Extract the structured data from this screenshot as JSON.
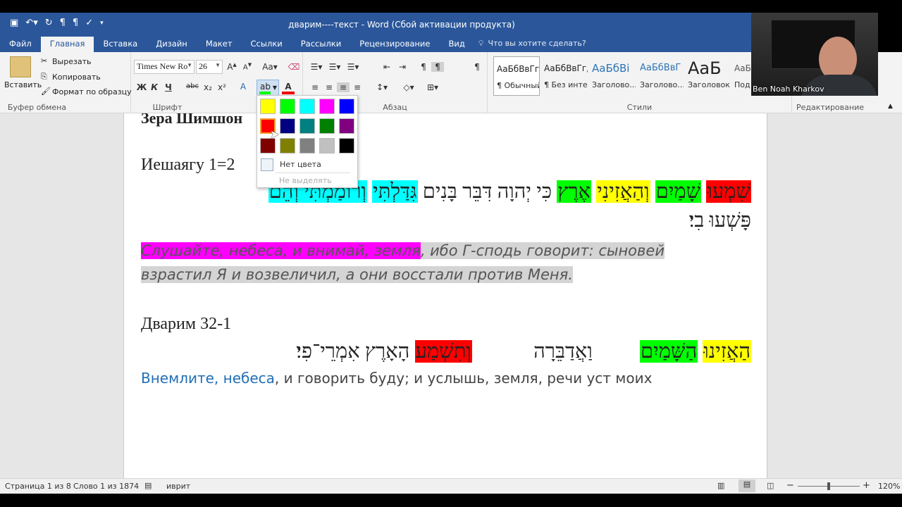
{
  "window": {
    "title": "дварим----текст - Word (Сбой активации продукта)"
  },
  "tabs": [
    "Файл",
    "Главная",
    "Вставка",
    "Дизайн",
    "Макет",
    "Ссылки",
    "Рассылки",
    "Рецензирование",
    "Вид"
  ],
  "tell_me": "Что вы хотите сделать?",
  "clipboard": {
    "paste": "Вставить",
    "cut": "Вырезать",
    "copy": "Копировать",
    "format_painter": "Формат по образцу",
    "label": "Буфер обмена"
  },
  "font": {
    "name": "Times New Ro",
    "size": "26",
    "bold": "Ж",
    "italic": "К",
    "underline": "Ч",
    "strike": "abc",
    "sub": "x₂",
    "sup": "x²",
    "label": "Шрифт"
  },
  "paragraph": {
    "label": "Абзац"
  },
  "styles": {
    "label": "Стили",
    "items": [
      {
        "preview": "АаБбВвГг,",
        "name": "¶ Обычный"
      },
      {
        "preview": "АаБбВвГг,",
        "name": "¶ Без инте..."
      },
      {
        "preview": "АаБбВі",
        "name": "Заголово..."
      },
      {
        "preview": "АаБбВвГ",
        "name": "Заголово..."
      },
      {
        "preview": "АаБ",
        "name": "Заголовок"
      },
      {
        "preview": "АаБ",
        "name": "Под"
      }
    ]
  },
  "editing": {
    "label": "Редактирование"
  },
  "highlight_menu": {
    "colors": [
      "#ffff00",
      "#00ff00",
      "#00ffff",
      "#ff00ff",
      "#0000ff",
      "#ff0000",
      "#000080",
      "#008080",
      "#008000",
      "#800080",
      "#800000",
      "#808000",
      "#808080",
      "#c0c0c0",
      "#000000"
    ],
    "no_color": "Нет цвета",
    "stop": "Не выделять"
  },
  "document": {
    "top_heading": "Зера Шимшон",
    "s1_title": "Иешаягу 1=2",
    "s1_hebrew_line1": [
      "שִׁמְעוּ",
      "שָׁמַיִם",
      "וְהַאֲזִינִי",
      "אֶרֶץ",
      "כִּי יְהוָה דִּבֵּר בָּנִים",
      "גִּדַּלְתִּי",
      "וְרוֹמַמְתִּי וְהֵם"
    ],
    "s1_hebrew_line2": "פָּשְׁעוּ בִי׃",
    "s1_ru_hl": "Слушайте, небеса, и внимай, земля",
    "s1_ru_rest": ", ибо Г-сподь говорит: сыновей",
    "s1_ru_line2": "взрастил Я и возвеличил, а они восстали против Меня.",
    "s2_title": "Дварим 32-1",
    "s2_hebrew": [
      "הַאֲזִינוּ",
      "הַשָּׁמַיִם",
      "וַאֲדַבֵּרָה",
      "וְתִשְׁמַע",
      "הָאָרֶץ אִמְרֵי־פִי׃"
    ],
    "s2_ru_blue": "Внемлите, небеса",
    "s2_ru_rest": ", и говорить буду; и услышь, земля, речи уст моих"
  },
  "status": {
    "page": "Страница 1 из 8",
    "words": "Слово 1 из 1874",
    "lang": "иврит",
    "zoom": "120%"
  },
  "video": {
    "name": "Ben Noah Kharkov"
  }
}
